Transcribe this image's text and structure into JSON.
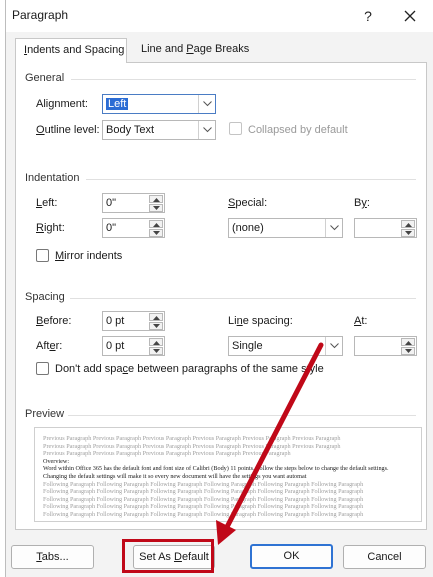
{
  "dialog": {
    "title": "Paragraph",
    "help_label": "?",
    "tabs": [
      {
        "label_pre": "",
        "label_key": "I",
        "label_post": "ndents and Spacing"
      },
      {
        "label_pre": "Line and ",
        "label_key": "P",
        "label_post": "age Breaks"
      }
    ]
  },
  "general": {
    "heading": "General",
    "alignment_label_pre": "Ali",
    "alignment_label_key": "g",
    "alignment_label_post": "nment:",
    "alignment_value": "Left",
    "outline_label_pre": "",
    "outline_label_key": "O",
    "outline_label_post": "utline level:",
    "outline_value": "Body Text",
    "collapsed_label": "Collapsed by default"
  },
  "indentation": {
    "heading": "Indentation",
    "left_label_pre": "",
    "left_label_key": "L",
    "left_label_post": "eft:",
    "left_value": "0\"",
    "right_label_pre": "",
    "right_label_key": "R",
    "right_label_post": "ight:",
    "right_value": "0\"",
    "special_label_pre": "",
    "special_label_key": "S",
    "special_label_post": "pecial:",
    "special_value": "(none)",
    "by_label_pre": "B",
    "by_label_key": "y",
    "by_label_post": ":",
    "by_value": "",
    "mirror_label_pre": "",
    "mirror_label_key": "M",
    "mirror_label_post": "irror indents"
  },
  "spacing": {
    "heading": "Spacing",
    "before_label_pre": "",
    "before_label_key": "B",
    "before_label_post": "efore:",
    "before_value": "0 pt",
    "after_label_pre": "Aft",
    "after_label_key": "e",
    "after_label_post": "r:",
    "after_value": "0 pt",
    "line_label_pre": "Li",
    "line_label_key": "n",
    "line_label_post": "e spacing:",
    "line_value": "Single",
    "at_label_pre": "",
    "at_label_key": "A",
    "at_label_post": "t:",
    "at_value": "",
    "dont_add_label_pre": "Don't add spa",
    "dont_add_label_key": "c",
    "dont_add_label_post": "e between paragraphs of the same style"
  },
  "preview": {
    "heading": "Preview",
    "previous_lines": [
      "Previous Paragraph Previous Paragraph Previous Paragraph Previous Paragraph Previous Paragraph Previous Paragraph",
      "Previous Paragraph Previous Paragraph Previous Paragraph Previous Paragraph Previous Paragraph Previous Paragraph",
      "Previous Paragraph Previous Paragraph Previous Paragraph Previous Paragraph Previous Paragraph"
    ],
    "sample_heading": "Overview:",
    "sample_text": "Word within Office 365 has the default font and font size of Calibri (Body) 11 points. Follow the steps below to change the default settings. Changing the default settings will make it so every new document will have the settings you want automat",
    "following_lines": [
      "Following Paragraph Following Paragraph Following Paragraph Following Paragraph Following Paragraph Following Paragraph",
      "Following Paragraph Following Paragraph Following Paragraph Following Paragraph Following Paragraph Following Paragraph",
      "Following Paragraph Following Paragraph Following Paragraph Following Paragraph Following Paragraph Following Paragraph",
      "Following Paragraph Following Paragraph Following Paragraph Following Paragraph Following Paragraph Following Paragraph",
      "Following Paragraph Following Paragraph Following Paragraph Following Paragraph Following Paragraph Following Paragraph"
    ]
  },
  "buttons": {
    "tabs_pre": "",
    "tabs_key": "T",
    "tabs_post": "abs...",
    "set_default_pre": "Set As ",
    "set_default_key": "D",
    "set_default_post": "efault",
    "ok": "OK",
    "cancel": "Cancel"
  },
  "annotation": {
    "color": "#c00818"
  }
}
